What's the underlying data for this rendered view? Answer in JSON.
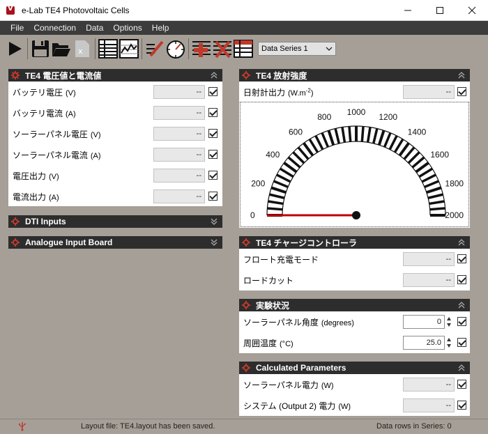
{
  "window": {
    "title": "e-Lab TE4 Photovoltaic Cells"
  },
  "menu": [
    "File",
    "Connection",
    "Data",
    "Options",
    "Help"
  ],
  "toolbar": {
    "series_select": "Data Series 1"
  },
  "panels": {
    "voltage_current": {
      "title": "TE4 電圧値と電流値",
      "rows": [
        {
          "label": "バッテリ電圧",
          "unit": "(V)",
          "value": "--"
        },
        {
          "label": "バッテリ電流",
          "unit": "(A)",
          "value": "--"
        },
        {
          "label": "ソーラーパネル電圧",
          "unit": "(V)",
          "value": "--"
        },
        {
          "label": "ソーラーパネル電流",
          "unit": "(A)",
          "value": "--"
        },
        {
          "label": "電圧出力",
          "unit": "(V)",
          "value": "--"
        },
        {
          "label": "電流出力",
          "unit": "(A)",
          "value": "--"
        }
      ]
    },
    "dti": {
      "title": "DTI Inputs"
    },
    "analogue": {
      "title": "Analogue Input Board"
    },
    "irradiance": {
      "title": "TE4 放射強度",
      "label": "日射計出力",
      "unit_base": "(W.m",
      "unit_sup": "-2",
      "unit_end": ")",
      "value": "--",
      "gauge": {
        "min": 0,
        "max": 2000,
        "value": 0,
        "tick_labels": [
          "0",
          "200",
          "400",
          "600",
          "800",
          "1000",
          "1200",
          "1400",
          "1600",
          "1800",
          "2000"
        ]
      }
    },
    "charge_controller": {
      "title": "TE4 チャージコントローラ",
      "rows": [
        {
          "label": "フロート充電モード",
          "value": "--"
        },
        {
          "label": "ロードカット",
          "value": "--"
        }
      ]
    },
    "experiment": {
      "title": "実験状況",
      "rows": [
        {
          "label": "ソーラーパネル角度",
          "unit": "(degrees)",
          "value": "0"
        },
        {
          "label": "周囲温度",
          "unit": "(°C)",
          "value": "25.0"
        }
      ]
    },
    "calculated": {
      "title": "Calculated Parameters",
      "rows": [
        {
          "label": "ソーラーパネル電力",
          "unit": "(W)",
          "value": "--"
        },
        {
          "label": "システム (Output 2) 電力",
          "unit": "(W)",
          "value": "--"
        }
      ]
    }
  },
  "status": {
    "layout": "Layout file: TE4.layout has been saved.",
    "rows": "Data rows in Series: 0"
  },
  "colors": {
    "header": "#2d2d2d",
    "background": "#a69f97",
    "needle": "#c00000",
    "gear": "#c0392b"
  }
}
